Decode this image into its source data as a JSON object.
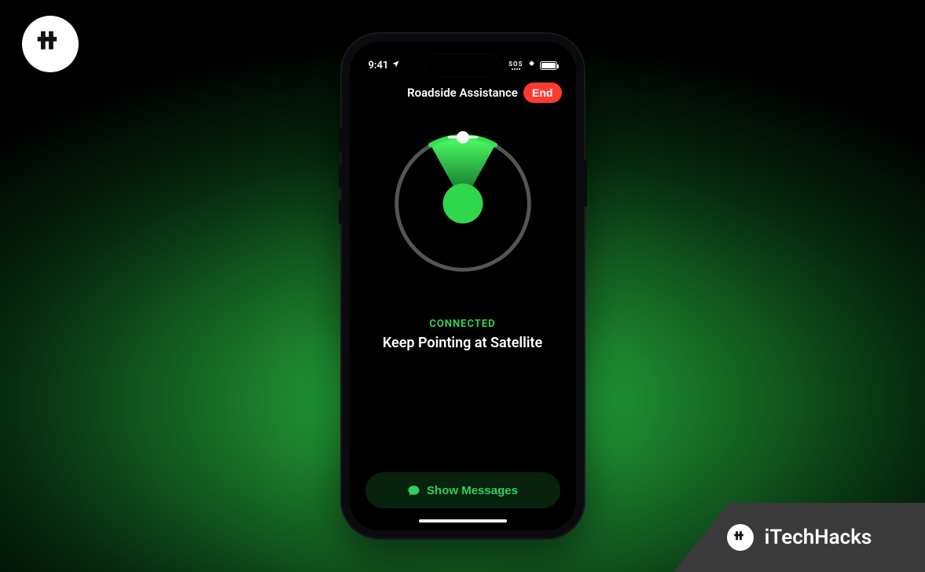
{
  "brand": {
    "name": "iTechHacks"
  },
  "status": {
    "time": "9:41",
    "sos": "SOS"
  },
  "nav": {
    "title": "Roadside Assistance",
    "end_label": "End"
  },
  "connection": {
    "state": "CONNECTED",
    "instruction": "Keep Pointing at Satellite"
  },
  "actions": {
    "show_messages": "Show Messages"
  },
  "colors": {
    "accent_green": "#30d158",
    "danger_red": "#ff3b30"
  }
}
